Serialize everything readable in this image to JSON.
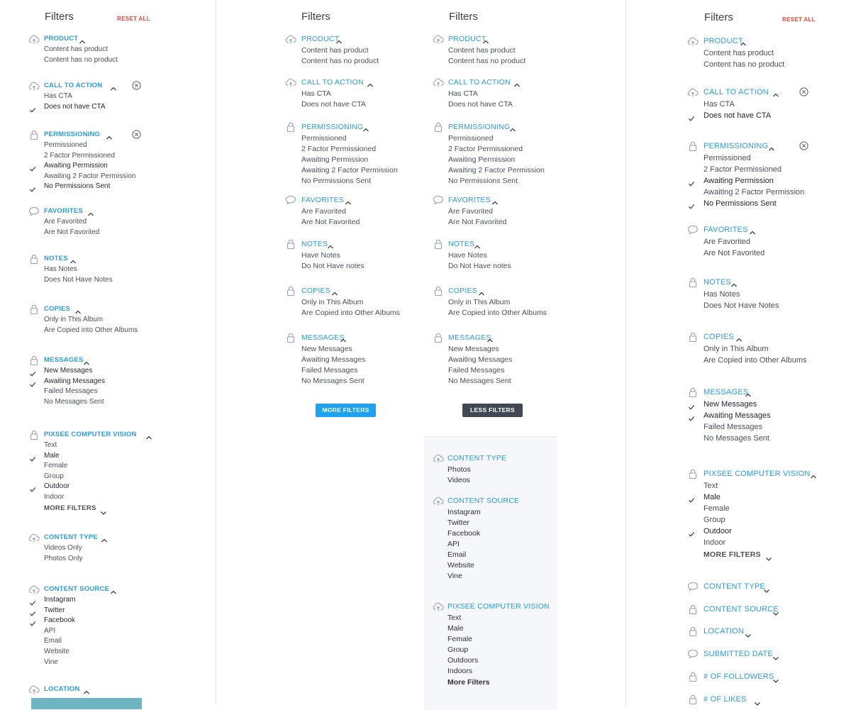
{
  "colors": {
    "accent": "#2b9be0",
    "danger": "#e8473a",
    "selected": "#1f2329",
    "muted": "#6b7078",
    "more_btn": "#1da1f2",
    "less_btn": "#3f4853"
  },
  "col1": {
    "title": "Filters",
    "reset": "RESET ALL",
    "sections": [
      {
        "title": "PRODUCT",
        "icon": "cloud-upload-icon",
        "caret": "up",
        "items": [
          {
            "label": "Content has product",
            "sel": false
          },
          {
            "label": "Content has no product",
            "sel": false
          }
        ]
      },
      {
        "title": "CALL TO ACTION",
        "icon": "cloud-upload-icon",
        "caret": "up",
        "clear": true,
        "items": [
          {
            "label": "Has CTA",
            "sel": false
          },
          {
            "label": "Does not have CTA",
            "sel": true
          }
        ]
      },
      {
        "title": "PERMISSIONING",
        "icon": "lock-icon",
        "caret": "up",
        "clear": true,
        "items": [
          {
            "label": "Permissioned",
            "sel": false
          },
          {
            "label": "2 Factor Permissioned",
            "sel": false
          },
          {
            "label": "Awaiting Permission",
            "sel": true
          },
          {
            "label": "Awaiting 2 Factor Permission",
            "sel": false
          },
          {
            "label": "No Permissions Sent",
            "sel": true
          }
        ]
      },
      {
        "title": "FAVORITES",
        "icon": "speech-bubble-icon",
        "caret": "up",
        "items": [
          {
            "label": "Are Favorited",
            "sel": false
          },
          {
            "label": "Are Not Favorited",
            "sel": false
          }
        ]
      },
      {
        "title": "NOTES",
        "icon": "lock-icon",
        "caret": "up",
        "items": [
          {
            "label": "Has Notes",
            "sel": false
          },
          {
            "label": "Does Not Have Notes",
            "sel": false
          }
        ]
      },
      {
        "title": "COPIES",
        "icon": "lock-icon",
        "caret": "up",
        "items": [
          {
            "label": "Only in This Album",
            "sel": false
          },
          {
            "label": "Are Copied into Other Albums",
            "sel": false
          }
        ]
      },
      {
        "title": "MESSAGES",
        "icon": "lock-icon",
        "caret": "up",
        "items": [
          {
            "label": "New Messages",
            "sel": true
          },
          {
            "label": "Awaiting Messages",
            "sel": true
          },
          {
            "label": "Failed Messages",
            "sel": false
          },
          {
            "label": "No Messages Sent",
            "sel": false
          }
        ]
      },
      {
        "title": "PIXSEE COMPUTER VISION",
        "icon": "lock-icon",
        "caret": "up",
        "items": [
          {
            "label": "Text",
            "sel": false
          },
          {
            "label": "Male",
            "sel": true
          },
          {
            "label": "Female",
            "sel": false
          },
          {
            "label": "Group",
            "sel": false
          },
          {
            "label": "Outdoor",
            "sel": true
          },
          {
            "label": "Indoor",
            "sel": false
          }
        ],
        "more": "MORE FILTERS"
      },
      {
        "title": "CONTENT TYPE",
        "icon": "cloud-upload-icon",
        "caret": "up",
        "items": [
          {
            "label": "Videos Only",
            "sel": false
          },
          {
            "label": "Photos Only",
            "sel": false
          }
        ]
      },
      {
        "title": "CONTENT SOURCE",
        "icon": "cloud-upload-icon",
        "caret": "up",
        "items": [
          {
            "label": "Instagram",
            "sel": true
          },
          {
            "label": "Twitter",
            "sel": true
          },
          {
            "label": "Facebook",
            "sel": true
          },
          {
            "label": "API",
            "sel": false
          },
          {
            "label": "Email",
            "sel": false
          },
          {
            "label": "Website",
            "sel": false
          },
          {
            "label": "Vine",
            "sel": false
          }
        ]
      },
      {
        "title": "LOCATION",
        "icon": "cloud-upload-icon",
        "caret": "up",
        "items": []
      }
    ]
  },
  "col2": {
    "title": "Filters",
    "more_button": "MORE FILTERS",
    "sections": [
      {
        "title": "PRODUCT",
        "icon": "cloud-upload-icon",
        "items": [
          "Content has product",
          "Content has no product"
        ]
      },
      {
        "title": "CALL TO ACTION",
        "icon": "cloud-upload-icon",
        "items": [
          "Has CTA",
          "Does not have CTA"
        ]
      },
      {
        "title": "PERMISSIONING",
        "icon": "lock-icon",
        "items": [
          "Permissioned",
          "2 Factor Permissioned",
          "Awaiting Permission",
          "Awaiting 2 Factor Permission",
          "No Permissions Sent"
        ]
      },
      {
        "title": "FAVORITES",
        "icon": "speech-bubble-icon",
        "items": [
          "Are Favorited",
          "Are Not Favorited"
        ]
      },
      {
        "title": "NOTES",
        "icon": "lock-icon",
        "items": [
          "Have Notes",
          "Do Not Have notes"
        ]
      },
      {
        "title": "COPIES",
        "icon": "lock-icon",
        "items": [
          "Only in This Album",
          "Are Copied into Other Albums"
        ]
      },
      {
        "title": "MESSAGES",
        "icon": "lock-icon",
        "items": [
          "New Messages",
          "Awaiting Messages",
          "Failed Messages",
          "No Messages Sent"
        ]
      }
    ]
  },
  "col3": {
    "title": "Filters",
    "less_button": "LESS FILTERS",
    "sections": [
      {
        "title": "PRODUCT",
        "icon": "cloud-upload-icon",
        "items": [
          "Content has product",
          "Content has no product"
        ]
      },
      {
        "title": "CALL TO ACTION",
        "icon": "cloud-upload-icon",
        "items": [
          "Has CTA",
          "Does not have CTA"
        ]
      },
      {
        "title": "PERMISSIONING",
        "icon": "lock-icon",
        "items": [
          "Permissioned",
          "2 Factor Permissioned",
          "Awaiting Permission",
          "Awaiting 2 Factor Permission",
          "No Permissions Sent"
        ]
      },
      {
        "title": "FAVORITES",
        "icon": "speech-bubble-icon",
        "items": [
          "Are Favorited",
          "Are Not Favorited"
        ]
      },
      {
        "title": "NOTES",
        "icon": "lock-icon",
        "items": [
          "Have Notes",
          "Do Not Have notes"
        ]
      },
      {
        "title": "COPIES",
        "icon": "lock-icon",
        "items": [
          "Only in This Album",
          "Are Copied into Other Albums"
        ]
      },
      {
        "title": "MESSAGES",
        "icon": "lock-icon",
        "items": [
          "New Messages",
          "Awaiting Messages",
          "Failed Messages",
          "No Messages Sent"
        ]
      }
    ],
    "panel": [
      {
        "title": "CONTENT TYPE",
        "icon": "cloud-upload-icon",
        "items": [
          "Photos",
          "Videos"
        ]
      },
      {
        "title": "CONTENT SOURCE",
        "icon": "cloud-upload-icon",
        "items": [
          "Instagram",
          "Twitter",
          "Facebook",
          "API",
          "Email",
          "Website",
          "Vine"
        ]
      },
      {
        "title": "PIXSEE COMPUTER VISION",
        "icon": "cloud-upload-icon",
        "items": [
          "Text",
          "Male",
          "Female",
          "Group",
          "Outdoors",
          "Indoors"
        ],
        "more": "More Filters"
      }
    ]
  },
  "col4": {
    "title": "Filters",
    "reset": "RESET ALL",
    "sections": [
      {
        "title": "PRODUCT",
        "icon": "cloud-upload-icon",
        "caret": "up",
        "items": [
          {
            "label": "Content has product",
            "sel": false
          },
          {
            "label": "Content has no product",
            "sel": false
          }
        ]
      },
      {
        "title": "CALL TO ACTION",
        "icon": "cloud-upload-icon",
        "caret": "up",
        "clear": true,
        "items": [
          {
            "label": "Has CTA",
            "sel": false
          },
          {
            "label": "Does not have CTA",
            "sel": true
          }
        ]
      },
      {
        "title": "PERMISSIONING",
        "icon": "lock-icon",
        "caret": "up",
        "clear": true,
        "items": [
          {
            "label": "Permissioned",
            "sel": false
          },
          {
            "label": "2 Factor Permissioned",
            "sel": false
          },
          {
            "label": "Awaiting Permission",
            "sel": true
          },
          {
            "label": "Awaiting 2 Factor Permission",
            "sel": false
          },
          {
            "label": "No Permissions Sent",
            "sel": true
          }
        ]
      },
      {
        "title": "FAVORITES",
        "icon": "speech-bubble-icon",
        "caret": "up",
        "items": [
          {
            "label": "Are Favorited",
            "sel": false
          },
          {
            "label": "Are Not Favorited",
            "sel": false
          }
        ]
      },
      {
        "title": "NOTES",
        "icon": "lock-icon",
        "caret": "up",
        "items": [
          {
            "label": "Has Notes",
            "sel": false
          },
          {
            "label": "Does Not Have Notes",
            "sel": false
          }
        ]
      },
      {
        "title": "COPIES",
        "icon": "lock-icon",
        "caret": "up",
        "items": [
          {
            "label": "Only in This Album",
            "sel": false
          },
          {
            "label": "Are Copied into Other Albums",
            "sel": false
          }
        ]
      },
      {
        "title": "MESSAGES",
        "icon": "lock-icon",
        "caret": "up",
        "items": [
          {
            "label": "New Messages",
            "sel": true
          },
          {
            "label": "Awaiting Messages",
            "sel": true
          },
          {
            "label": "Failed Messages",
            "sel": false
          },
          {
            "label": "No Messages Sent",
            "sel": false
          }
        ]
      },
      {
        "title": "PIXSEE COMPUTER VISION",
        "icon": "lock-icon",
        "caret": "up",
        "items": [
          {
            "label": "Text",
            "sel": false
          },
          {
            "label": "Male",
            "sel": true
          },
          {
            "label": "Female",
            "sel": false
          },
          {
            "label": "Group",
            "sel": false
          },
          {
            "label": "Outdoor",
            "sel": true
          },
          {
            "label": "Indoor",
            "sel": false
          }
        ],
        "more": "MORE FILTERS"
      },
      {
        "title": "CONTENT TYPE",
        "icon": "speech-bubble-icon",
        "caret": "down",
        "items": []
      },
      {
        "title": "CONTENT SOURCE",
        "icon": "lock-icon",
        "caret": "down",
        "items": []
      },
      {
        "title": "LOCATION",
        "icon": "lock-icon",
        "caret": "down",
        "items": []
      },
      {
        "title": "SUBMITTED DATE",
        "icon": "speech-bubble-icon",
        "caret": "down",
        "items": []
      },
      {
        "title": "# OF FOLLOWERS",
        "icon": "lock-icon",
        "caret": "down",
        "items": []
      },
      {
        "title": "# OF LIKES",
        "icon": "lock-icon",
        "caret": "down",
        "items": []
      }
    ]
  }
}
